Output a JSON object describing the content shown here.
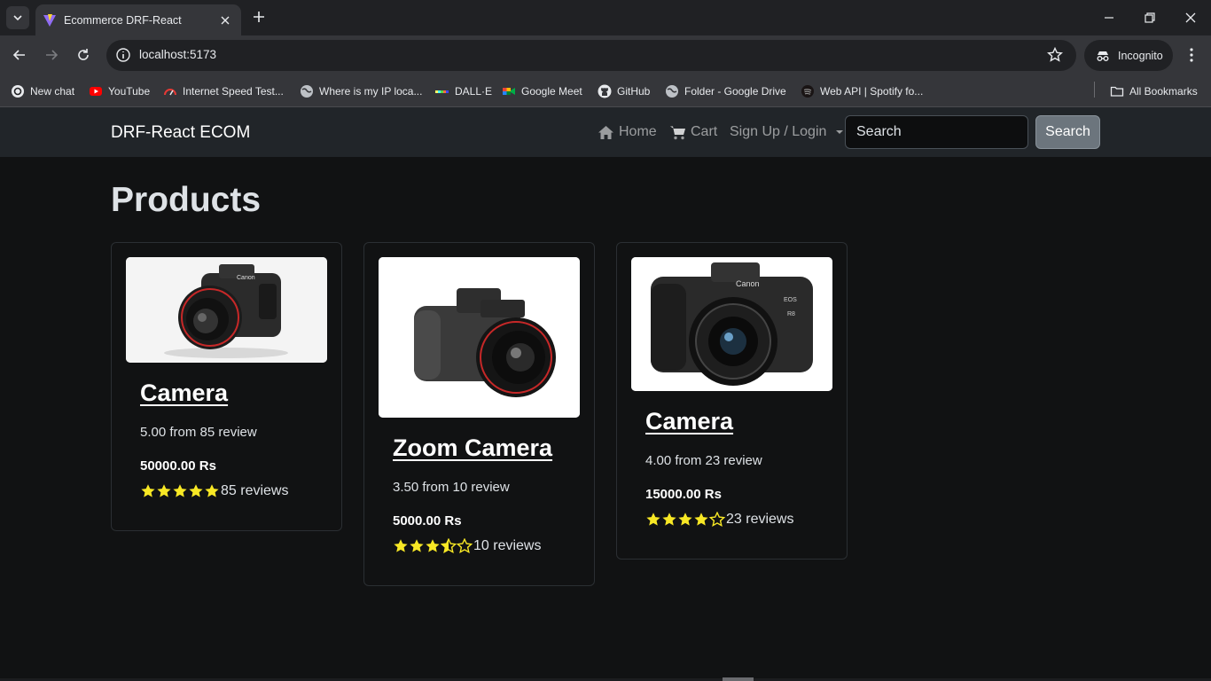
{
  "browser": {
    "tab_title": "Ecommerce DRF-React",
    "url": "localhost:5173",
    "incognito_label": "Incognito",
    "bookmarks": [
      {
        "label": "New chat",
        "icon": "chatgpt-icon"
      },
      {
        "label": "YouTube",
        "icon": "youtube-icon"
      },
      {
        "label": "Internet Speed Test...",
        "icon": "speedtest-icon"
      },
      {
        "label": "Where is my IP loca...",
        "icon": "globe-icon"
      },
      {
        "label": "DALL·E",
        "icon": "dalle-icon"
      },
      {
        "label": "Google Meet",
        "icon": "google-meet-icon"
      },
      {
        "label": "GitHub",
        "icon": "github-icon"
      },
      {
        "label": "Folder - Google Drive",
        "icon": "globe-icon"
      },
      {
        "label": "Web API | Spotify fo...",
        "icon": "spotify-icon"
      }
    ],
    "all_bookmarks_label": "All Bookmarks"
  },
  "navbar": {
    "brand": "DRF-React ECOM",
    "home_label": "Home",
    "cart_label": "Cart",
    "account_label": "Sign Up / Login",
    "search_placeholder": "Search",
    "search_button": "Search"
  },
  "page": {
    "title": "Products"
  },
  "products": [
    {
      "name": "Camera",
      "rating_text": "5.00 from 85 review",
      "price": "50000.00 Rs",
      "rating": 5.0,
      "reviews_label": "85 reviews"
    },
    {
      "name": "Zoom Camera",
      "rating_text": "3.50 from 10 review",
      "price": "5000.00 Rs",
      "rating": 3.5,
      "reviews_label": "10 reviews"
    },
    {
      "name": "Camera",
      "rating_text": "4.00 from 23 review",
      "price": "15000.00 Rs",
      "rating": 4.0,
      "reviews_label": "23 reviews"
    }
  ],
  "colors": {
    "star": "#f8e825",
    "navbar_bg": "#212529",
    "page_bg": "#111213"
  }
}
